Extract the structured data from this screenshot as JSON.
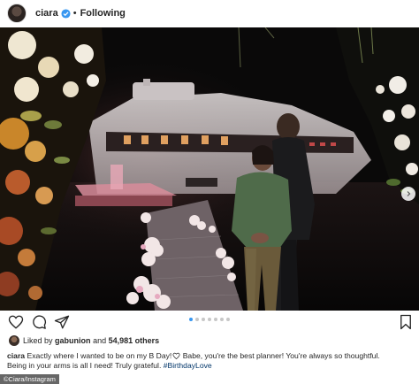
{
  "header": {
    "username": "ciara",
    "separator": "•",
    "follow_status": "Following",
    "verified": true
  },
  "photo": {
    "description_icon": "photo",
    "carousel": {
      "total": 7,
      "active_index": 0
    }
  },
  "actions": {
    "like_icon": "heart-icon",
    "comment_icon": "comment-icon",
    "share_icon": "share-icon",
    "save_icon": "bookmark-icon"
  },
  "likes": {
    "prefix": "Liked by",
    "user": "gabunion",
    "connector": "and",
    "count": "54,981 others"
  },
  "caption": {
    "username": "ciara",
    "text_1": "Exactly where I wanted to be on my B Day!",
    "text_2": " Babe, you're the best planner! You're always so thoughtful.",
    "text_3": "Being in your arms is all I need! Truly grateful.",
    "hashtag": "#BirthdayLove"
  },
  "credit": {
    "text": "©Ciara/Instagram"
  },
  "colors": {
    "link": "#003569",
    "accent": "#3897f0",
    "text": "#262626"
  }
}
